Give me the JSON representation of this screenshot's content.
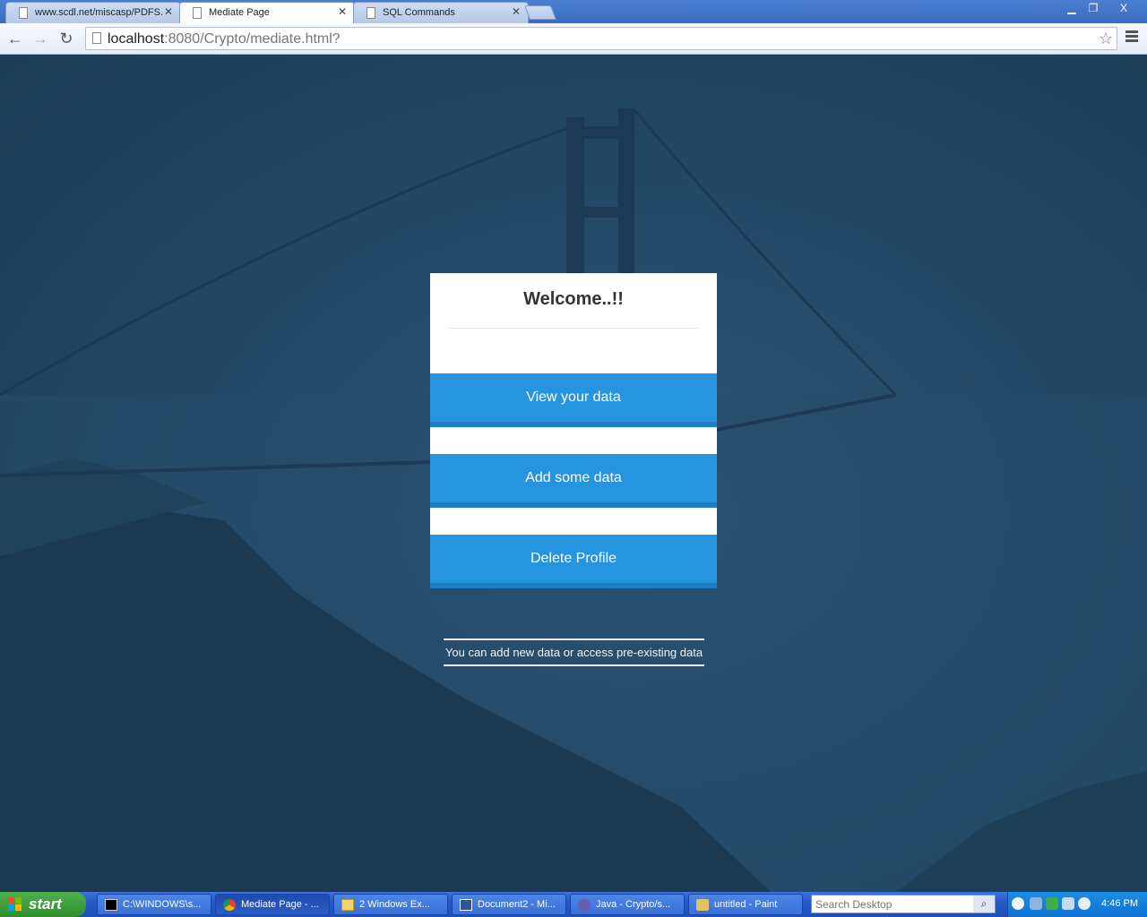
{
  "browser": {
    "tabs": [
      {
        "label": "www.scdl.net/miscasp/PDFS.",
        "active": false
      },
      {
        "label": "Mediate Page",
        "active": true
      },
      {
        "label": "SQL Commands",
        "active": false
      }
    ],
    "url_host": "localhost",
    "url_rest": ":8080/Crypto/mediate.html?",
    "window_controls": {
      "minimize": "▁",
      "restore": "❐",
      "close": "X"
    }
  },
  "page": {
    "title": "Welcome..!!",
    "buttons": {
      "view": "View your data",
      "add": "Add some data",
      "delete": "Delete Profile"
    },
    "footnote": "You can add new data or access pre-existing data",
    "colors": {
      "button": "#2794e0",
      "background": "#234a68"
    }
  },
  "taskbar": {
    "start_label": "start",
    "items": [
      {
        "label": "C:\\WINDOWS\\s..."
      },
      {
        "label": "Mediate Page - ..."
      },
      {
        "label": "2 Windows Ex..."
      },
      {
        "label": "Document2 - Mi..."
      },
      {
        "label": "Java - Crypto/s..."
      },
      {
        "label": "untitled - Paint"
      }
    ],
    "search_placeholder": "Search Desktop",
    "clock": "4:46 PM"
  }
}
